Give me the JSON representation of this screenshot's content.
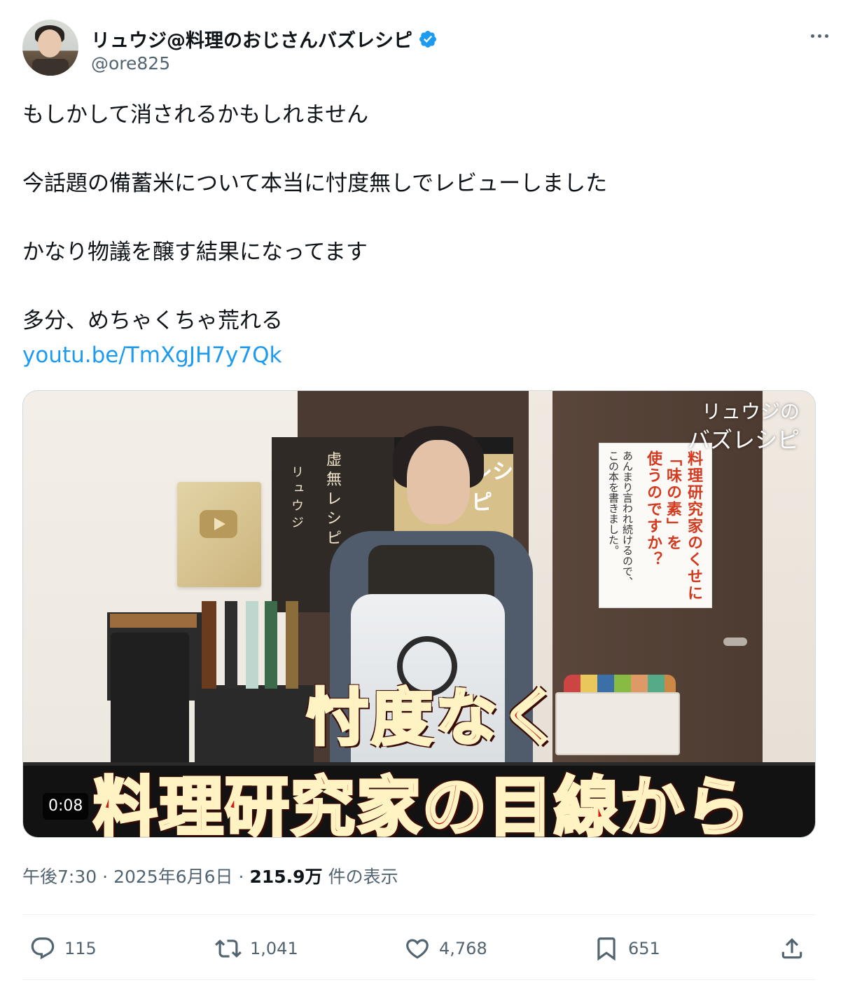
{
  "author": {
    "display_name": "リュウジ@料理のおじさんバズレシピ",
    "handle": "@ore825",
    "verified": true,
    "verified_color": "#1d9bf0"
  },
  "tweet": {
    "lines": [
      "もしかして消されるかもしれません",
      "",
      "今話題の備蓄米について本当に忖度無しでレビューしました",
      "",
      "かなり物議を醸す結果になってます",
      "",
      "多分、めちゃくちゃ荒れる"
    ],
    "link": "youtu.be/TmXgJH7y7Qk",
    "link_color": "#1d9bf0"
  },
  "video": {
    "watermark_line1": "リュウジの",
    "watermark_line2": "バズレシピ",
    "caption_line1": "忖度なく",
    "caption_line2": "料理研究家の目線から",
    "duration": "0:08",
    "poster_left_title": "虚無レシピ",
    "poster_left_author": "リュウジ",
    "poster_right_big": "レシピ",
    "ad_col1": "料理研究家のくせに",
    "ad_col2": "「味の素」を",
    "ad_col3": "使うのですか？",
    "ad_col4": "あんまり言われ続けるので、",
    "ad_col5": "この本を書きました。"
  },
  "meta": {
    "time": "午後7:30",
    "separator1": "·",
    "date": "2025年6月6日",
    "separator2": "·",
    "views": "215.9万",
    "views_label": "件の表示"
  },
  "actions": {
    "reply_count": "115",
    "retweet_count": "1,041",
    "like_count": "4,768",
    "bookmark_count": "651"
  }
}
